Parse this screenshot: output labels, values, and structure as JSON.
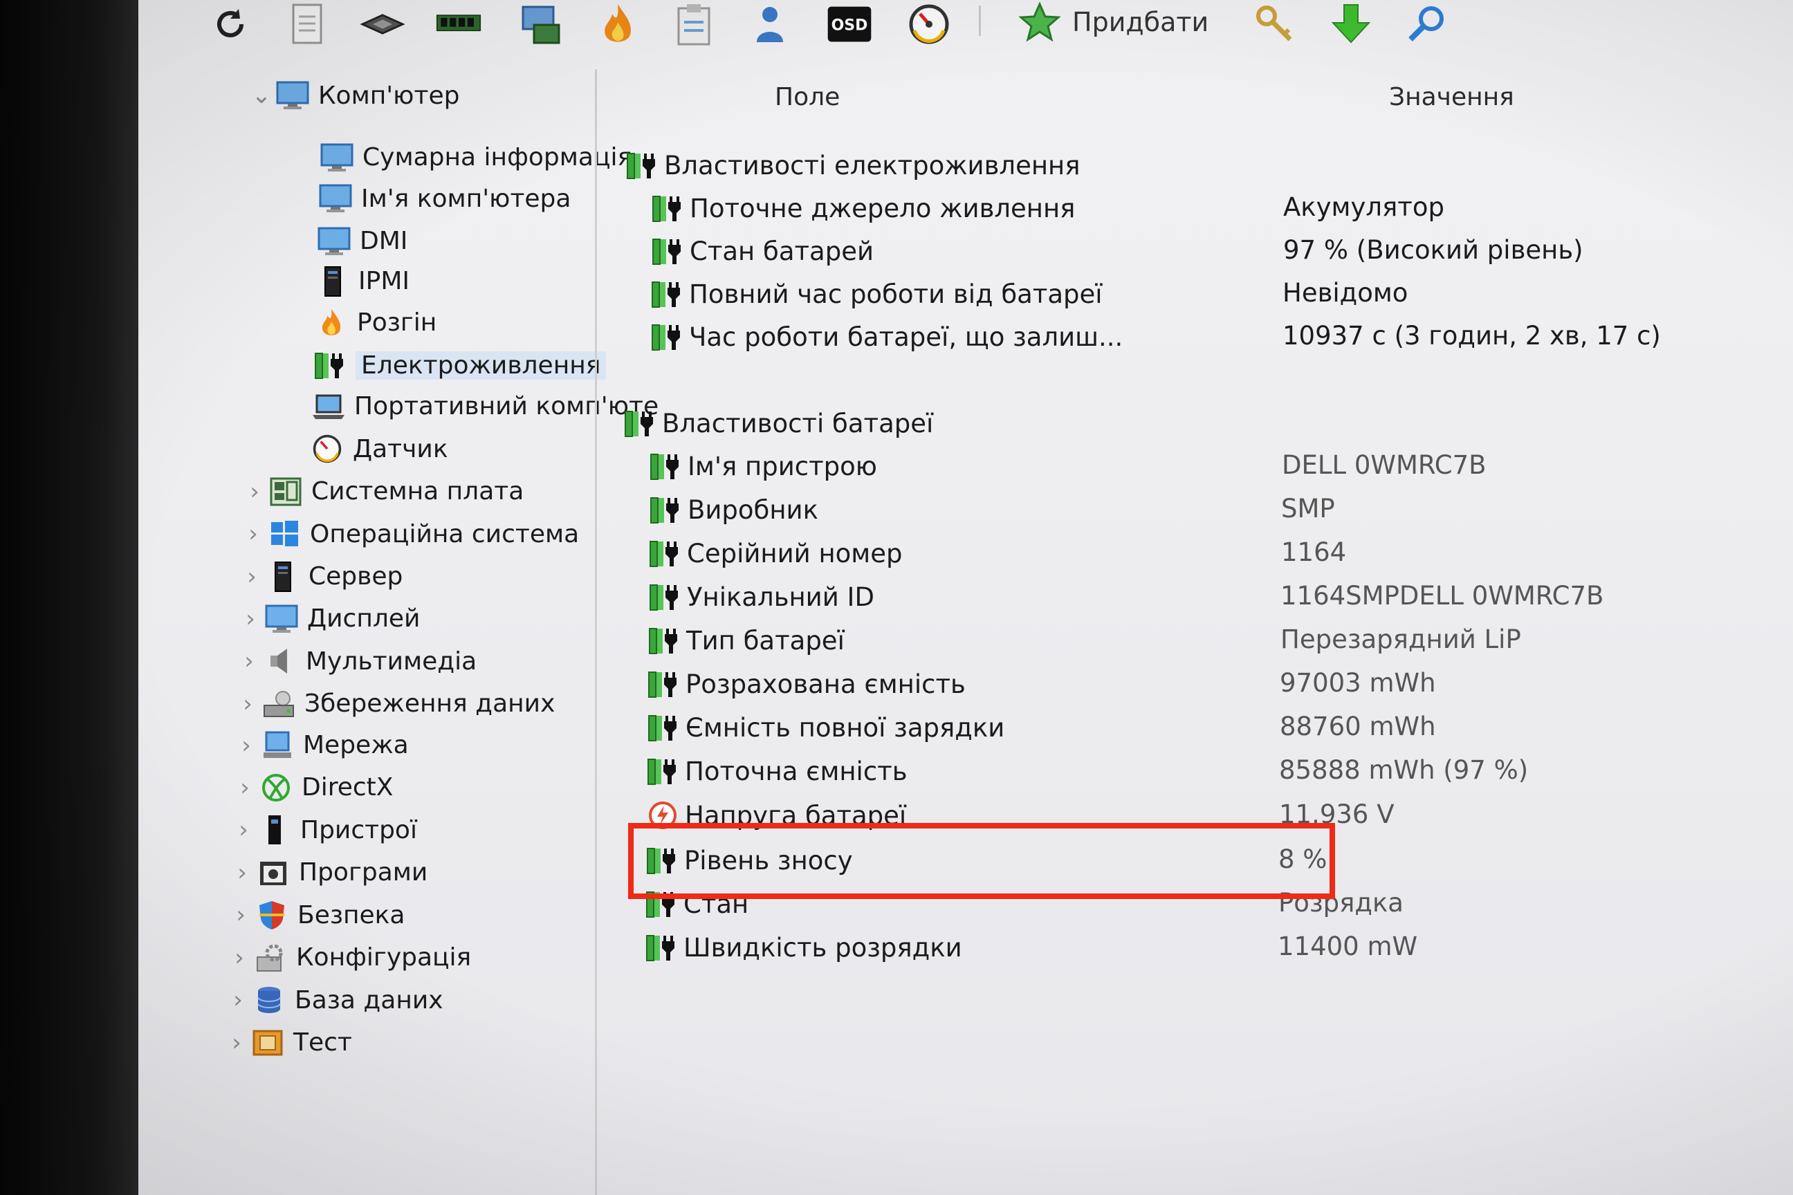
{
  "toolbar": {
    "buttons": [
      "refresh-icon",
      "report-icon",
      "motherboard-icon",
      "memory-icon",
      "network-card-icon",
      "flame-icon",
      "clipboard-icon",
      "user-icon",
      "osd-icon",
      "gauge-icon"
    ],
    "osd_label": "OSD",
    "buy_label": "Придбати",
    "tools": [
      "key-icon",
      "download-arrow-icon",
      "search-icon"
    ]
  },
  "tree": {
    "items": [
      {
        "label": "Комп'ютер",
        "icon": "monitor-icon",
        "expander": "expanded"
      },
      {
        "label": "Сумарна інформація",
        "icon": "monitor-icon"
      },
      {
        "label": "Ім'я комп'ютера",
        "icon": "monitor-icon"
      },
      {
        "label": "DMI",
        "icon": "monitor-icon"
      },
      {
        "label": "IPMI",
        "icon": "server-tower-icon"
      },
      {
        "label": "Розгін",
        "icon": "flame-icon"
      },
      {
        "label": "Електроживлення",
        "icon": "battery-plug-icon",
        "selected": true
      },
      {
        "label": "Портативний комп'юте",
        "icon": "laptop-icon"
      },
      {
        "label": "Датчик",
        "icon": "gauge-icon"
      },
      {
        "label": "Системна плата",
        "icon": "motherboard-icon",
        "expander": "collapsed"
      },
      {
        "label": "Операційна система",
        "icon": "windows-logo-icon",
        "expander": "collapsed"
      },
      {
        "label": "Сервер",
        "icon": "server-tower-icon",
        "expander": "collapsed"
      },
      {
        "label": "Дисплей",
        "icon": "monitor-icon",
        "expander": "collapsed"
      },
      {
        "label": "Мультимедіа",
        "icon": "speaker-icon",
        "expander": "collapsed"
      },
      {
        "label": "Збереження даних",
        "icon": "storage-drive-icon",
        "expander": "collapsed"
      },
      {
        "label": "Мережа",
        "icon": "network-icon",
        "expander": "collapsed"
      },
      {
        "label": "DirectX",
        "icon": "xbox-logo-icon",
        "expander": "collapsed"
      },
      {
        "label": "Пристрої",
        "icon": "device-icon",
        "expander": "collapsed"
      },
      {
        "label": "Програми",
        "icon": "program-window-icon",
        "expander": "collapsed"
      },
      {
        "label": "Безпека",
        "icon": "shield-icon",
        "expander": "collapsed"
      },
      {
        "label": "Конфігурація",
        "icon": "config-gear-icon",
        "expander": "collapsed"
      },
      {
        "label": "База даних",
        "icon": "database-icon",
        "expander": "collapsed"
      },
      {
        "label": "Тест",
        "icon": "benchmark-icon",
        "expander": "collapsed"
      }
    ]
  },
  "list": {
    "header": {
      "field": "Поле",
      "value": "Значення"
    },
    "rows": [
      {
        "type": "group",
        "field": "Властивості електроживлення",
        "value": "",
        "icon": "battery-plug-icon"
      },
      {
        "type": "item",
        "field": "Поточне джерело живлення",
        "value": "Акумулятор",
        "icon": "battery-plug-icon"
      },
      {
        "type": "item",
        "field": "Стан батарей",
        "value": "97 % (Високий рівень)",
        "icon": "battery-plug-icon"
      },
      {
        "type": "item",
        "field": "Повний час роботи від батареї",
        "value": "Невідомо",
        "icon": "battery-plug-icon"
      },
      {
        "type": "item",
        "field": "Час роботи батареї, що залиш...",
        "value": "10937 с (3 годин, 2 хв, 17 с)",
        "icon": "battery-plug-icon"
      },
      {
        "type": "group",
        "field": "Властивості батареї",
        "value": "",
        "icon": "battery-plug-icon"
      },
      {
        "type": "item",
        "field": "Ім'я пристрою",
        "value": "DELL 0WMRC7B",
        "icon": "battery-plug-icon"
      },
      {
        "type": "item",
        "field": "Виробник",
        "value": "SMP",
        "icon": "battery-plug-icon"
      },
      {
        "type": "item",
        "field": "Серійний номер",
        "value": "1164",
        "icon": "battery-plug-icon"
      },
      {
        "type": "item",
        "field": "Унікальний ID",
        "value": "1164SMPDELL 0WMRC7B",
        "icon": "battery-plug-icon"
      },
      {
        "type": "item",
        "field": "Тип батареї",
        "value": "Перезарядний LiP",
        "icon": "battery-plug-icon"
      },
      {
        "type": "item",
        "field": "Розрахована ємність",
        "value": "97003 mWh",
        "icon": "battery-plug-icon"
      },
      {
        "type": "item",
        "field": "Ємність повної зарядки",
        "value": "88760 mWh",
        "icon": "battery-plug-icon"
      },
      {
        "type": "item",
        "field": "Поточна ємність",
        "value": "85888 mWh  (97 %)",
        "icon": "battery-plug-icon"
      },
      {
        "type": "item",
        "field": "Напруга батареї",
        "value": "11.936 V",
        "icon": "voltage-icon"
      },
      {
        "type": "item",
        "field": "Рівень зносу",
        "value": "8 %",
        "icon": "battery-plug-icon",
        "highlighted": true
      },
      {
        "type": "item",
        "field": "Стан",
        "value": "Розрядка",
        "icon": "battery-plug-icon"
      },
      {
        "type": "item",
        "field": "Швидкість розрядки",
        "value": "11400 mW",
        "icon": "battery-plug-icon"
      }
    ]
  },
  "colors": {
    "highlight_border": "#ef2a16",
    "battery_green": "#3aa53a",
    "selection": "#d9e5f3"
  }
}
